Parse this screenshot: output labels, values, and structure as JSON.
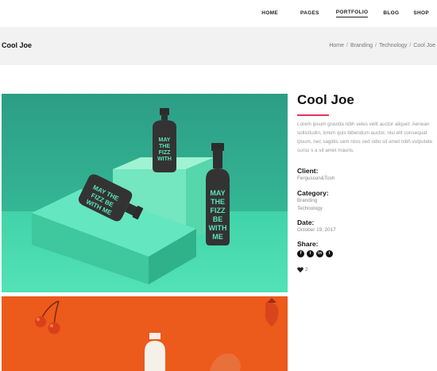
{
  "nav": {
    "items": [
      {
        "label": "HOME"
      },
      {
        "label": "PAGES"
      },
      {
        "label": "PORTFOLIO"
      },
      {
        "label": "BLOG"
      },
      {
        "label": "SHOP"
      }
    ],
    "active": "PORTFOLIO"
  },
  "titlebar": {
    "title": "Cool Joe",
    "breadcrumb": [
      "Home",
      "Branding",
      "Technology",
      "Cool Joe"
    ],
    "separator": "/"
  },
  "project": {
    "title": "Cool Joe",
    "accent_color": "#e8335a",
    "description": "Lorem ipsum gravida nibh veles velit auctor aliquet. Aenean sollicitudin, lorem quis bibendum auctor, nisi elit consequat ipsum, nec sagittis sem nisis sed odio sit amet nibh vulputate cursu s a sit amet mauris.",
    "client_label": "Client:",
    "client_value": "Fergusson&Tosh",
    "category_label": "Category:",
    "categories": [
      "Branding",
      "Technology"
    ],
    "date_label": "Date:",
    "date_value": "October 19, 2017",
    "share_label": "Share:",
    "share_icons": [
      "facebook-icon",
      "twitter-icon",
      "linkedin-icon",
      "tumblr-icon"
    ],
    "likes": "2"
  },
  "images": {
    "main_bottle_text": [
      "MAY",
      "THE",
      "FIZZ",
      "BE",
      "WITH",
      "ME"
    ],
    "main_bg": "#2fa98a",
    "second_bg": "#ec5a1c"
  }
}
